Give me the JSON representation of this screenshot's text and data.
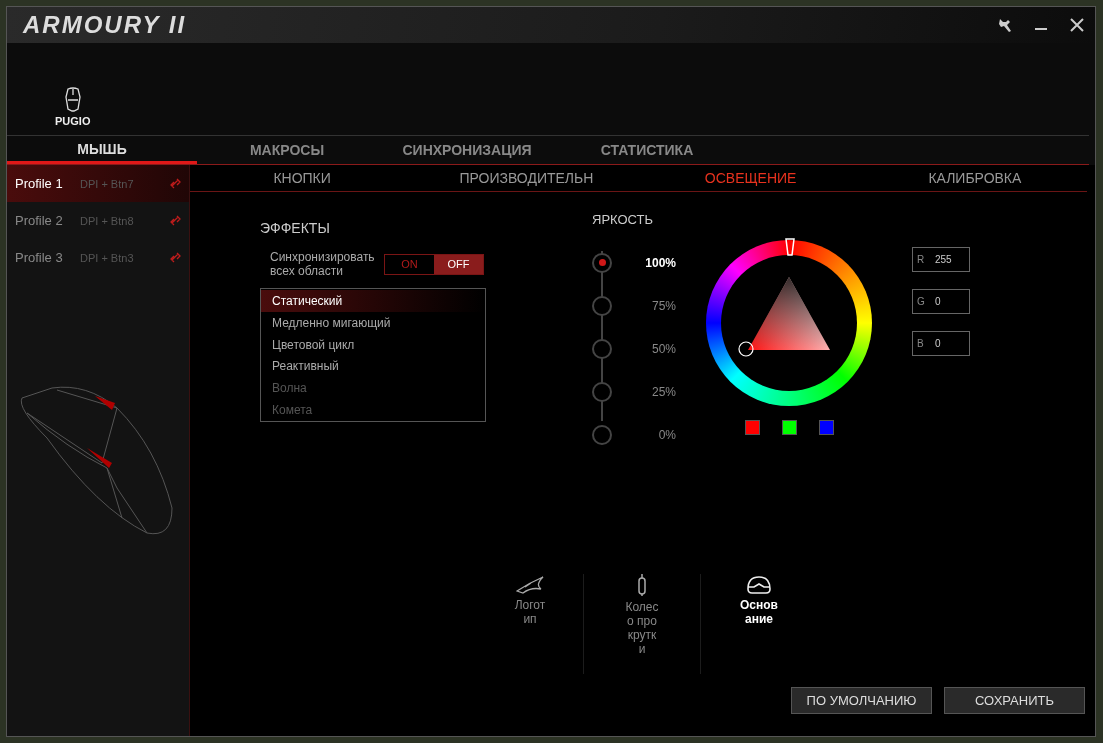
{
  "window": {
    "title": "ARMOURY II",
    "device": "PUGIO"
  },
  "main_tabs": [
    {
      "label": "МЫШЬ",
      "selected": true
    },
    {
      "label": "МАКРОСЫ",
      "selected": false
    },
    {
      "label": "СИНХРОНИЗАЦИЯ",
      "selected": false
    },
    {
      "label": "СТАТИСТИКА",
      "selected": false
    }
  ],
  "profiles": [
    {
      "name": "Profile 1",
      "binding": "DPI + Btn7",
      "selected": true
    },
    {
      "name": "Profile 2",
      "binding": "DPI + Btn8",
      "selected": false
    },
    {
      "name": "Profile 3",
      "binding": "DPI + Btn3",
      "selected": false
    }
  ],
  "sub_tabs": [
    {
      "label": "КНОПКИ",
      "selected": false
    },
    {
      "label": "ПРОИЗВОДИТЕЛЬН",
      "selected": false
    },
    {
      "label": "ОСВЕЩЕНИЕ",
      "selected": true
    },
    {
      "label": "КАЛИБРОВКА",
      "selected": false
    }
  ],
  "effects": {
    "title": "ЭФФЕКТЫ",
    "sync": {
      "label": "Синхронизировать всех области",
      "on": false,
      "on_label": "ON",
      "off_label": "OFF"
    },
    "items": [
      {
        "label": "Статический",
        "selected": true,
        "disabled": false
      },
      {
        "label": "Медленно мигающий",
        "selected": false,
        "disabled": false
      },
      {
        "label": "Цветовой цикл",
        "selected": false,
        "disabled": false
      },
      {
        "label": "Реактивный",
        "selected": false,
        "disabled": false
      },
      {
        "label": "Волна",
        "selected": false,
        "disabled": true
      },
      {
        "label": "Комета",
        "selected": false,
        "disabled": true
      }
    ]
  },
  "brightness": {
    "title": "ЯРКОСТЬ",
    "stops": [
      {
        "label": "100%",
        "selected": true
      },
      {
        "label": "75%",
        "selected": false
      },
      {
        "label": "50%",
        "selected": false
      },
      {
        "label": "25%",
        "selected": false
      },
      {
        "label": "0%",
        "selected": false
      }
    ]
  },
  "rgb": [
    {
      "channel": "R",
      "value": "255"
    },
    {
      "channel": "G",
      "value": "0"
    },
    {
      "channel": "B",
      "value": "0"
    }
  ],
  "presets": [
    {
      "color": "#ff0000"
    },
    {
      "color": "#00ff00"
    },
    {
      "color": "#0000ff"
    }
  ],
  "zones": [
    {
      "kind": "logo",
      "label": "Логотип",
      "selected": false
    },
    {
      "kind": "wheel",
      "label": "Колесо прокрутки",
      "selected": false
    },
    {
      "kind": "base",
      "label": "Основание",
      "selected": true
    }
  ],
  "buttons": [
    "ПО УМОЛЧАНИЮ",
    "СОХРАНИТЬ"
  ]
}
